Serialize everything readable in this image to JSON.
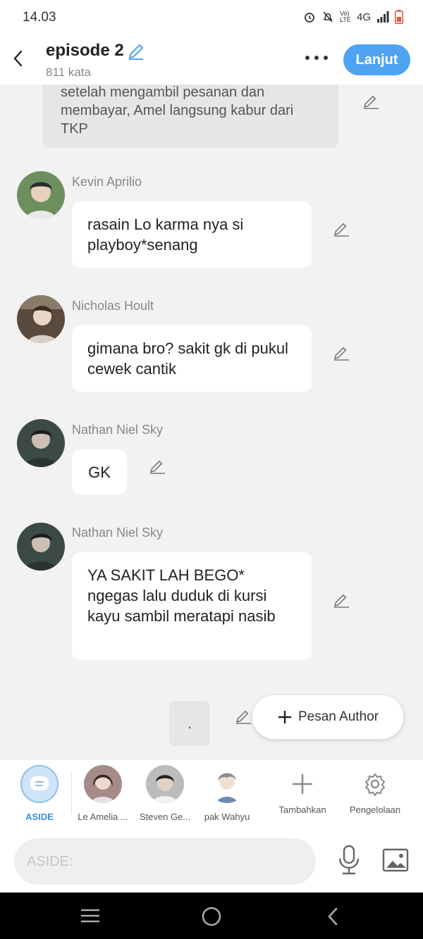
{
  "status": {
    "time": "14.03",
    "network": "4G",
    "volte": "Vo) LTE"
  },
  "header": {
    "title": "episode 2",
    "word_count": "811 kata",
    "next_label": "Lanjut"
  },
  "narration": {
    "text": "setelah mengambil pesanan dan membayar, Amel langsung kabur dari TKP"
  },
  "messages": [
    {
      "name": "Kevin Aprilio",
      "text": "rasain Lo karma nya si playboy*senang"
    },
    {
      "name": "Nicholas Hoult",
      "text": "gimana bro? sakit gk di pukul cewek cantik"
    },
    {
      "name": "Nathan Niel Sky",
      "text": "GK"
    },
    {
      "name": "Nathan Niel Sky",
      "text": "YA SAKIT LAH BEGO* ngegas lalu duduk di kursi kayu sambil meratapi nasib"
    }
  ],
  "dot_bubble": ".",
  "pesan_author": {
    "label": "Pesan Author"
  },
  "characters": [
    {
      "label": "ASIDE"
    },
    {
      "label": "Le Amelia ..."
    },
    {
      "label": "Steven Ge..."
    },
    {
      "label": "pak Wahyu"
    },
    {
      "label": "Tambahkan"
    },
    {
      "label": "Pengelolaan"
    }
  ],
  "input": {
    "placeholder": "ASIDE:"
  },
  "colors": {
    "accent": "#4fa3f3",
    "aside_active": "#3b8fe0",
    "background": "#f2f2f2"
  }
}
